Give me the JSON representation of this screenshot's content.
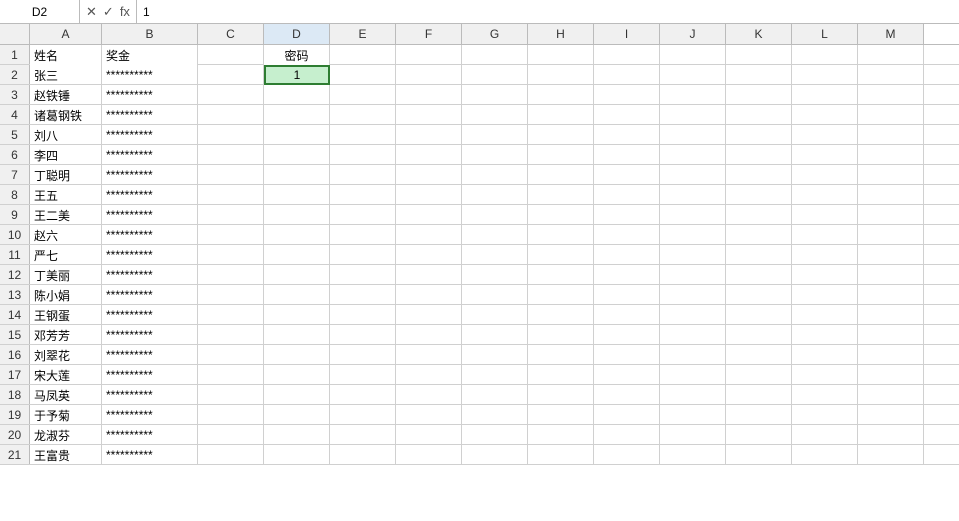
{
  "formulaBar": {
    "cellRef": "D2",
    "cancelLabel": "✕",
    "confirmLabel": "✓",
    "funcLabel": "fx",
    "formula": "1"
  },
  "columns": [
    {
      "id": "A",
      "label": "A",
      "class": "col-a"
    },
    {
      "id": "B",
      "label": "B",
      "class": "col-b"
    },
    {
      "id": "C",
      "label": "C",
      "class": "col-c"
    },
    {
      "id": "D",
      "label": "D",
      "class": "col-d"
    },
    {
      "id": "E",
      "label": "E",
      "class": "col-e"
    },
    {
      "id": "F",
      "label": "F",
      "class": "col-f"
    },
    {
      "id": "G",
      "label": "G",
      "class": "col-g"
    },
    {
      "id": "H",
      "label": "H",
      "class": "col-h"
    },
    {
      "id": "I",
      "label": "I",
      "class": "col-i"
    },
    {
      "id": "J",
      "label": "J",
      "class": "col-j"
    },
    {
      "id": "K",
      "label": "K",
      "class": "col-k"
    },
    {
      "id": "L",
      "label": "L",
      "class": "col-l"
    },
    {
      "id": "M",
      "label": "M",
      "class": "col-m"
    }
  ],
  "rows": [
    {
      "num": 1,
      "a": "姓名",
      "b": "奖金",
      "c": "",
      "d": "密码",
      "isHeader": true
    },
    {
      "num": 2,
      "a": "张三",
      "b": "**********",
      "c": "",
      "d": "1",
      "isActive": true
    },
    {
      "num": 3,
      "a": "赵铁锤",
      "b": "**********",
      "c": "",
      "d": ""
    },
    {
      "num": 4,
      "a": "诸葛钢铁",
      "b": "**********",
      "c": "",
      "d": ""
    },
    {
      "num": 5,
      "a": "刘八",
      "b": "**********",
      "c": "",
      "d": ""
    },
    {
      "num": 6,
      "a": "李四",
      "b": "**********",
      "c": "",
      "d": ""
    },
    {
      "num": 7,
      "a": "丁聪明",
      "b": "**********",
      "c": "",
      "d": ""
    },
    {
      "num": 8,
      "a": "王五",
      "b": "**********",
      "c": "",
      "d": ""
    },
    {
      "num": 9,
      "a": "王二美",
      "b": "**********",
      "c": "",
      "d": ""
    },
    {
      "num": 10,
      "a": "赵六",
      "b": "**********",
      "c": "",
      "d": ""
    },
    {
      "num": 11,
      "a": "严七",
      "b": "**********",
      "c": "",
      "d": ""
    },
    {
      "num": 12,
      "a": "丁美丽",
      "b": "**********",
      "c": "",
      "d": ""
    },
    {
      "num": 13,
      "a": "陈小娟",
      "b": "**********",
      "c": "",
      "d": ""
    },
    {
      "num": 14,
      "a": "王钢蛋",
      "b": "**********",
      "c": "",
      "d": ""
    },
    {
      "num": 15,
      "a": "邓芳芳",
      "b": "**********",
      "c": "",
      "d": ""
    },
    {
      "num": 16,
      "a": "刘翠花",
      "b": "**********",
      "c": "",
      "d": ""
    },
    {
      "num": 17,
      "a": "宋大莲",
      "b": "**********",
      "c": "",
      "d": ""
    },
    {
      "num": 18,
      "a": "马凤英",
      "b": "**********",
      "c": "",
      "d": ""
    },
    {
      "num": 19,
      "a": "于予菊",
      "b": "**********",
      "c": "",
      "d": ""
    },
    {
      "num": 20,
      "a": "龙淑芬",
      "b": "**********",
      "c": "",
      "d": ""
    },
    {
      "num": 21,
      "a": "王富贵",
      "b": "**********",
      "c": "",
      "d": ""
    }
  ]
}
